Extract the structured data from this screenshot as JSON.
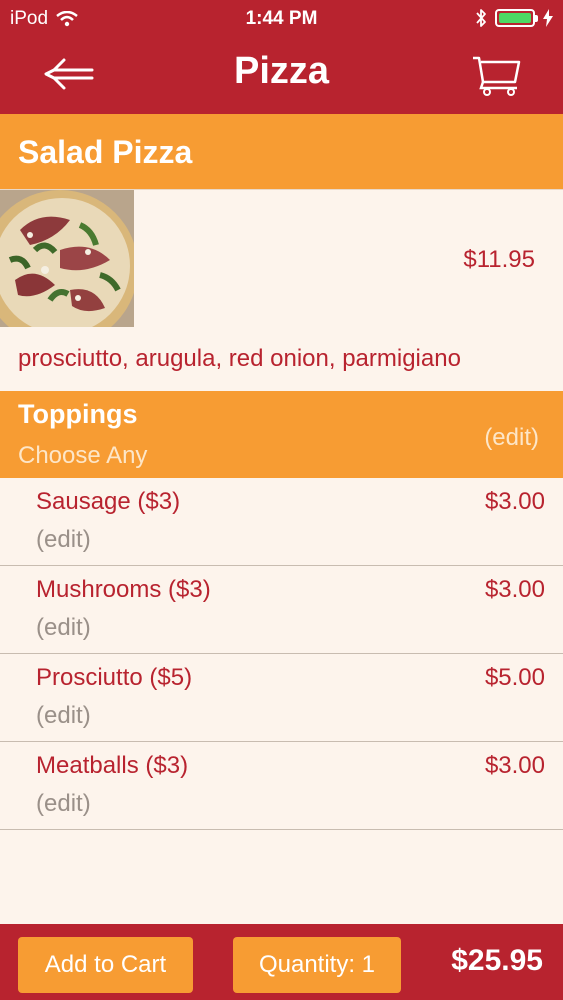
{
  "status_bar": {
    "carrier": "iPod",
    "time": "1:44 PM",
    "battery_color": "#4cd964"
  },
  "nav": {
    "title": "Pizza",
    "back_icon": "back-arrow-icon",
    "cart_icon": "shopping-cart-icon"
  },
  "item": {
    "name": "Salad Pizza",
    "price": "$11.95",
    "description": "prosciutto, arugula, red onion, parmigiano"
  },
  "toppings": {
    "title": "Toppings",
    "subtitle": "Choose Any",
    "edit_label": "(edit)",
    "items": [
      {
        "name": "Sausage ($3)",
        "price": "$3.00",
        "edit": "(edit)"
      },
      {
        "name": "Mushrooms ($3)",
        "price": "$3.00",
        "edit": "(edit)"
      },
      {
        "name": "Prosciutto ($5)",
        "price": "$5.00",
        "edit": "(edit)"
      },
      {
        "name": "Meatballs ($3)",
        "price": "$3.00",
        "edit": "(edit)"
      }
    ]
  },
  "footer": {
    "add_to_cart_label": "Add to Cart",
    "quantity_label": "Quantity: 1",
    "total": "$25.95"
  },
  "colors": {
    "brand_red": "#b8232f",
    "accent_orange": "#f79c33",
    "background": "#fdf4ec"
  }
}
